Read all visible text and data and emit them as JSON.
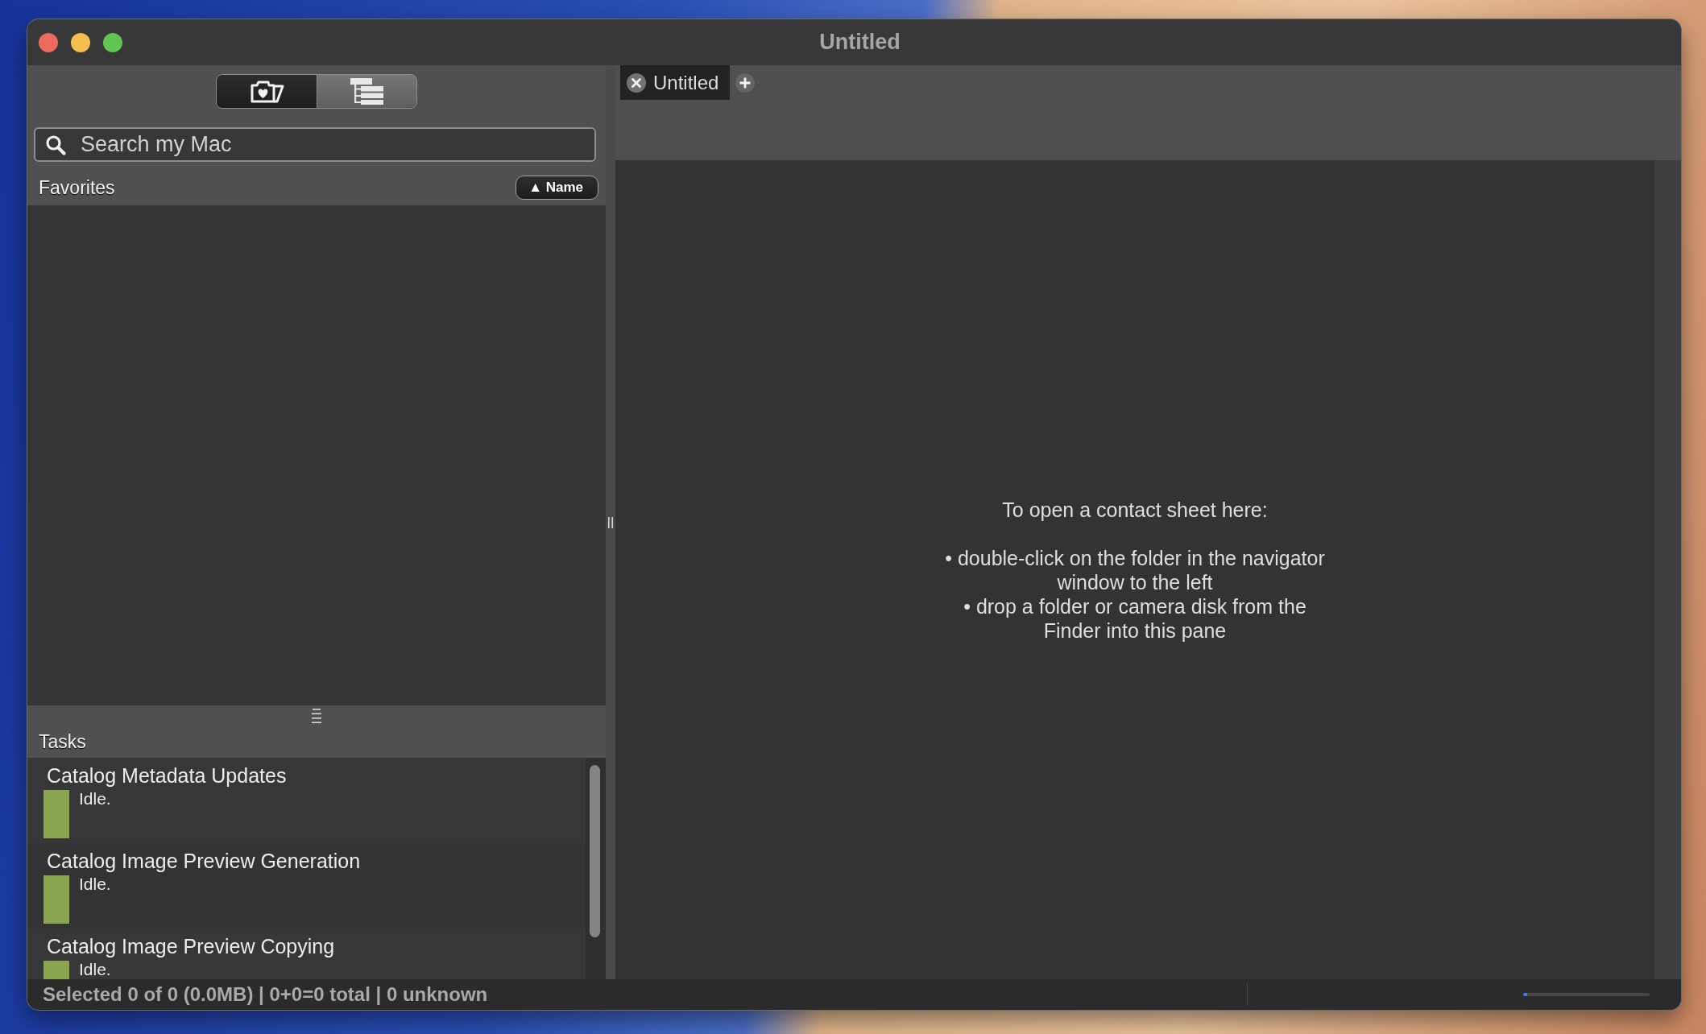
{
  "window": {
    "title": "Untitled"
  },
  "sidebar": {
    "view_switcher": [
      {
        "kind": "favorites",
        "selected": true
      },
      {
        "kind": "tree",
        "selected": false
      }
    ],
    "search": {
      "placeholder": "Search my Mac"
    },
    "favorites": {
      "title": "Favorites",
      "sort_button": {
        "label": "▲ Name"
      }
    },
    "tasks": {
      "title": "Tasks",
      "items": [
        {
          "name": "Catalog Metadata Updates",
          "status": "Idle."
        },
        {
          "name": "Catalog Image Preview Generation",
          "status": "Idle."
        },
        {
          "name": "Catalog Image Preview Copying",
          "status": "Idle."
        }
      ]
    }
  },
  "tabs": [
    {
      "label": "Untitled",
      "selected": true
    }
  ],
  "content": {
    "heading": "To open a contact sheet here:",
    "bullets": [
      "• double-click on the folder in the navigator window to the left",
      "• drop a folder or camera disk from the Finder into this pane"
    ]
  },
  "status_bar": {
    "summary": "Selected 0 of 0 (0.0MB) | 0+0=0 total | 0 unknown",
    "progress": {
      "level": 0.03
    }
  }
}
